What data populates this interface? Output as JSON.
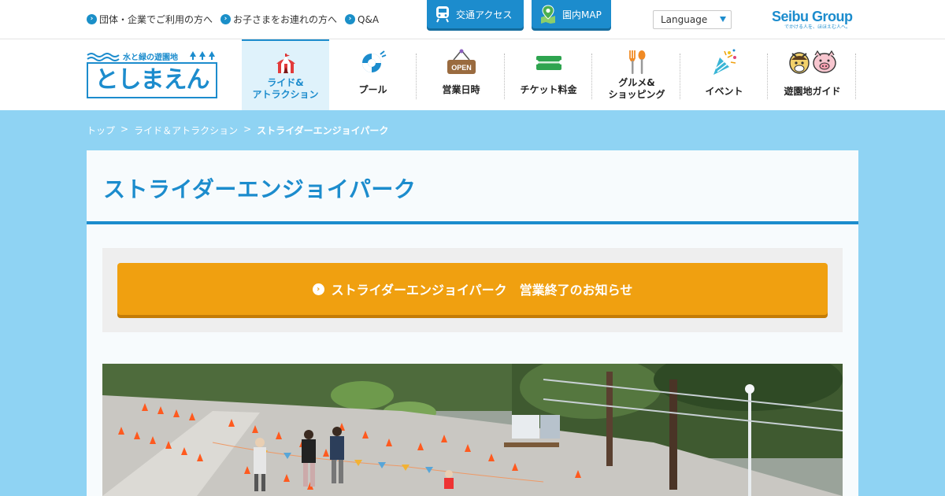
{
  "topbar": {
    "links": [
      {
        "label": "団体・企業でご利用の方へ"
      },
      {
        "label": "お子さまをお連れの方へ"
      },
      {
        "label": "Q&A"
      }
    ],
    "access_label": "交通アクセス",
    "map_label": "園内MAP",
    "language_label": "Language",
    "group_logo": "Seibu Group",
    "group_tagline": "でかける人を、ほほえむ人へ。"
  },
  "logo": {
    "tagline": "水と緑の遊園地",
    "name": "としまえん"
  },
  "nav": {
    "items": [
      {
        "label": "ライド&\nアトラクション",
        "icon": "circus-tent-icon"
      },
      {
        "label": "プール",
        "icon": "swim-ring-icon"
      },
      {
        "label": "営業日時",
        "icon": "open-sign-icon",
        "sign_text": "OPEN"
      },
      {
        "label": "チケット料金",
        "icon": "ticket-icon"
      },
      {
        "label": "グルメ&\nショッピング",
        "icon": "fork-spoon-icon"
      },
      {
        "label": "イベント",
        "icon": "party-popper-icon"
      },
      {
        "label": "遊園地ガイド",
        "icon": "animal-characters-icon"
      }
    ]
  },
  "breadcrumb": {
    "items": [
      "トップ",
      "ライド＆アトラクション",
      "ストライダーエンジョイパーク"
    ],
    "separator": ">"
  },
  "page": {
    "title": "ストライダーエンジョイパーク",
    "notice_label": "ストライダーエンジョイパーク　営業終了のお知らせ"
  },
  "colors": {
    "brand_blue": "#1c8ccd",
    "background_sky": "#8fd3f3",
    "notice_orange": "#f0a010"
  }
}
